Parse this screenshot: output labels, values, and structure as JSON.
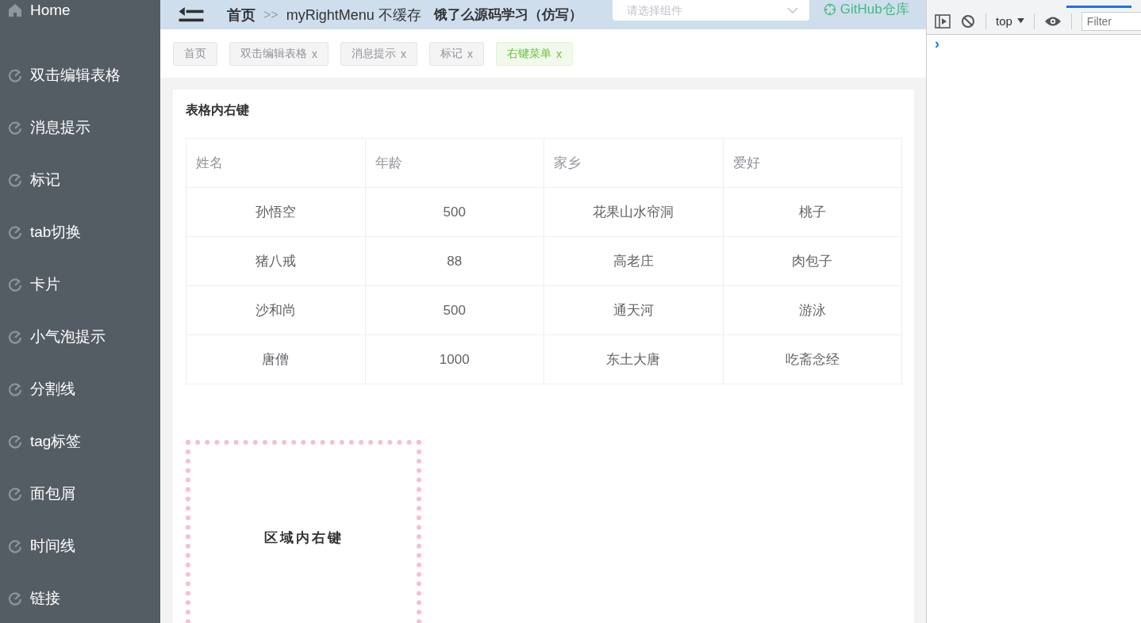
{
  "sidebar": {
    "items": [
      {
        "label": "Home",
        "kind": "home",
        "selected": false
      },
      {
        "label": "双击编辑表格",
        "kind": "page",
        "selected": false
      },
      {
        "label": "消息提示",
        "kind": "page",
        "selected": false
      },
      {
        "label": "标记",
        "kind": "page",
        "selected": false
      },
      {
        "label": "tab切换",
        "kind": "page",
        "selected": false
      },
      {
        "label": "卡片",
        "kind": "page",
        "selected": false
      },
      {
        "label": "小气泡提示",
        "kind": "page",
        "selected": false
      },
      {
        "label": "分割线",
        "kind": "page",
        "selected": false
      },
      {
        "label": "tag标签",
        "kind": "page",
        "selected": false
      },
      {
        "label": "面包屑",
        "kind": "page",
        "selected": false
      },
      {
        "label": "时间线",
        "kind": "page",
        "selected": false
      },
      {
        "label": "链接",
        "kind": "page",
        "selected": false
      }
    ]
  },
  "header": {
    "breadcrumb": [
      "首页",
      "myRightMenu 不缓存"
    ],
    "separator": ">>",
    "title": "饿了么源码学习（仿写）",
    "select": {
      "placeholder": "请选择组件"
    },
    "link": "GitHub仓库"
  },
  "tags": [
    {
      "label": "首页",
      "selected": false
    },
    {
      "label": "双击编辑表格",
      "close_mark": "x",
      "selected": false
    },
    {
      "label": "消息提示",
      "close_mark": "x",
      "selected": false
    },
    {
      "label": "标记",
      "close_mark": "x",
      "selected": false
    },
    {
      "label": "右键菜单",
      "close_mark": "x",
      "selected": true
    }
  ],
  "card": {
    "title": "表格内右键",
    "table": {
      "columns": [
        "姓名",
        "年龄",
        "家乡",
        "爱好"
      ],
      "rows": [
        [
          "孙悟空",
          "500",
          "花果山水帘洞",
          "桃子"
        ],
        [
          "猪八戒",
          "88",
          "高老庄",
          "肉包子"
        ],
        [
          "沙和尚",
          "500",
          "通天河",
          "游泳"
        ],
        [
          "唐僧",
          "1000",
          "东土大唐",
          "吃斋念经"
        ]
      ]
    },
    "area_label": "区域内右键"
  },
  "devtools": {
    "context": "top",
    "filter_placeholder": "Filter",
    "prompt": "›"
  }
}
